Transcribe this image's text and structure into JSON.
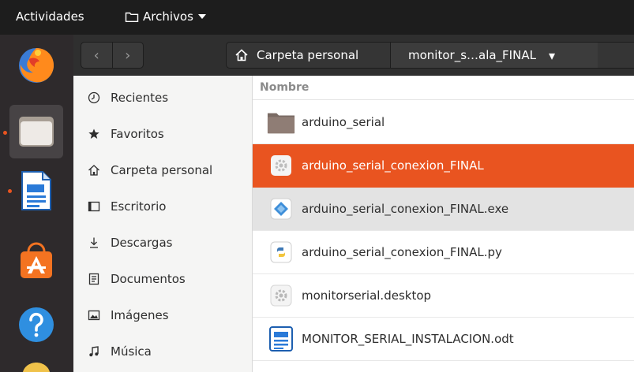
{
  "topbar": {
    "activities_label": "Actividades",
    "app_menu_label": "Archivos",
    "app_menu_icon": "folder-outline-icon"
  },
  "dock": {
    "items": [
      {
        "icon": "firefox-icon",
        "running": false
      },
      {
        "icon": "files-icon",
        "running": true,
        "active": true
      },
      {
        "icon": "writer-icon",
        "running": true
      },
      {
        "icon": "software-center-icon",
        "running": false
      },
      {
        "icon": "help-icon",
        "running": false
      }
    ]
  },
  "headerbar": {
    "back_glyph": "‹",
    "forward_glyph": "›",
    "breadcrumb": {
      "home_label": "Carpeta personal",
      "current_label": "monitor_s…ala_FINAL",
      "dropdown_glyph": "▾"
    }
  },
  "sidebar": {
    "places": [
      {
        "label": "Recientes",
        "icon": "clock-icon"
      },
      {
        "label": "Favoritos",
        "icon": "star-icon"
      },
      {
        "label": "Carpeta personal",
        "icon": "home-icon"
      },
      {
        "label": "Escritorio",
        "icon": "desktop-icon"
      },
      {
        "label": "Descargas",
        "icon": "download-icon"
      },
      {
        "label": "Documentos",
        "icon": "document-icon"
      },
      {
        "label": "Imágenes",
        "icon": "image-icon"
      },
      {
        "label": "Música",
        "icon": "music-icon"
      }
    ]
  },
  "files": {
    "column_name_label": "Nombre",
    "items": [
      {
        "name": "arduino_serial",
        "icon": "folder-icon",
        "state": "normal"
      },
      {
        "name": "arduino_serial_conexion_FINAL",
        "icon": "executable-icon",
        "state": "selected"
      },
      {
        "name": "arduino_serial_conexion_FINAL.exe",
        "icon": "exe-icon",
        "state": "hover"
      },
      {
        "name": "arduino_serial_conexion_FINAL.py",
        "icon": "python-icon",
        "state": "normal"
      },
      {
        "name": "monitorserial.desktop",
        "icon": "desktop-file-icon",
        "state": "normal"
      },
      {
        "name": "MONITOR_SERIAL_INSTALACION.odt",
        "icon": "odt-icon",
        "state": "normal"
      }
    ]
  },
  "colors": {
    "accent": "#e95420",
    "dock_bg": "#2e2a2c",
    "headerbar_bg": "#2f2f2f",
    "sidebar_bg": "#f5f5f4"
  }
}
